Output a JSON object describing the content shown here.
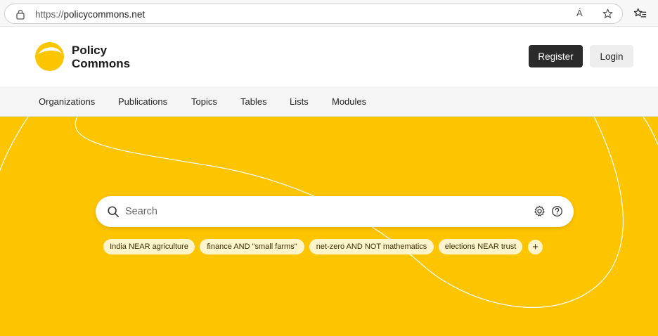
{
  "browser": {
    "url_scheme": "https://",
    "url_host": "policycommons.net",
    "read_aloud_label": "Á"
  },
  "header": {
    "logo_line1": "Policy",
    "logo_line2": "Commons",
    "register_label": "Register",
    "login_label": "Login"
  },
  "nav": {
    "items": [
      {
        "label": "Organizations"
      },
      {
        "label": "Publications"
      },
      {
        "label": "Topics"
      },
      {
        "label": "Tables"
      },
      {
        "label": "Lists"
      },
      {
        "label": "Modules"
      }
    ]
  },
  "search": {
    "placeholder": "Search"
  },
  "suggestions": [
    {
      "label": "India NEAR agriculture"
    },
    {
      "label": "finance AND \"small farms\""
    },
    {
      "label": "net-zero AND NOT mathematics"
    },
    {
      "label": "elections NEAR trust"
    }
  ],
  "add_chip_label": "+",
  "colors": {
    "brand_yellow": "#fdc400",
    "chip_bg": "#fff4cc",
    "register_bg": "#2a2a2a"
  }
}
